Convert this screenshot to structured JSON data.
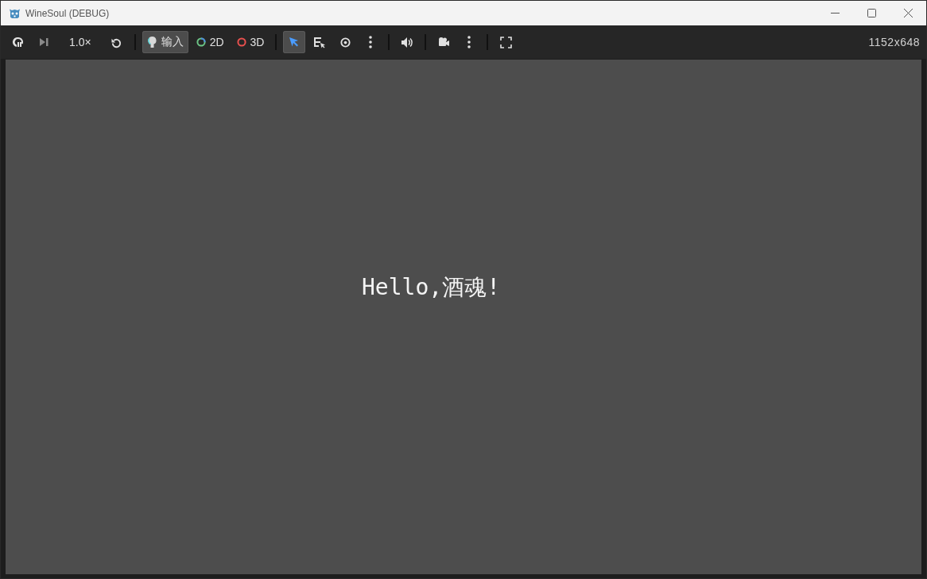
{
  "window": {
    "title": "WineSoul (DEBUG)"
  },
  "toolbar": {
    "items": [
      {
        "kind": "suspend",
        "selected": false
      },
      {
        "kind": "next-frame",
        "selected": false
      },
      {
        "kind": "speed",
        "label": "1.0×"
      },
      {
        "kind": "reset",
        "selected": false
      },
      {
        "kind": "separator"
      },
      {
        "kind": "input",
        "label": "输入",
        "selected": true
      },
      {
        "kind": "mode-2d",
        "label": "2D",
        "selected": false
      },
      {
        "kind": "mode-3d",
        "label": "3D",
        "selected": false
      },
      {
        "kind": "separator"
      },
      {
        "kind": "select",
        "selected": true
      },
      {
        "kind": "list-select",
        "selected": false
      },
      {
        "kind": "visibility",
        "selected": false
      },
      {
        "kind": "more",
        "selected": false
      },
      {
        "kind": "separator"
      },
      {
        "kind": "audio",
        "selected": false
      },
      {
        "kind": "separator"
      },
      {
        "kind": "camera",
        "selected": false
      },
      {
        "kind": "more",
        "selected": false
      },
      {
        "kind": "separator"
      },
      {
        "kind": "fullscreen",
        "selected": false
      }
    ],
    "resolution": "1152x648"
  },
  "game": {
    "text": "Hello,酒魂!"
  }
}
